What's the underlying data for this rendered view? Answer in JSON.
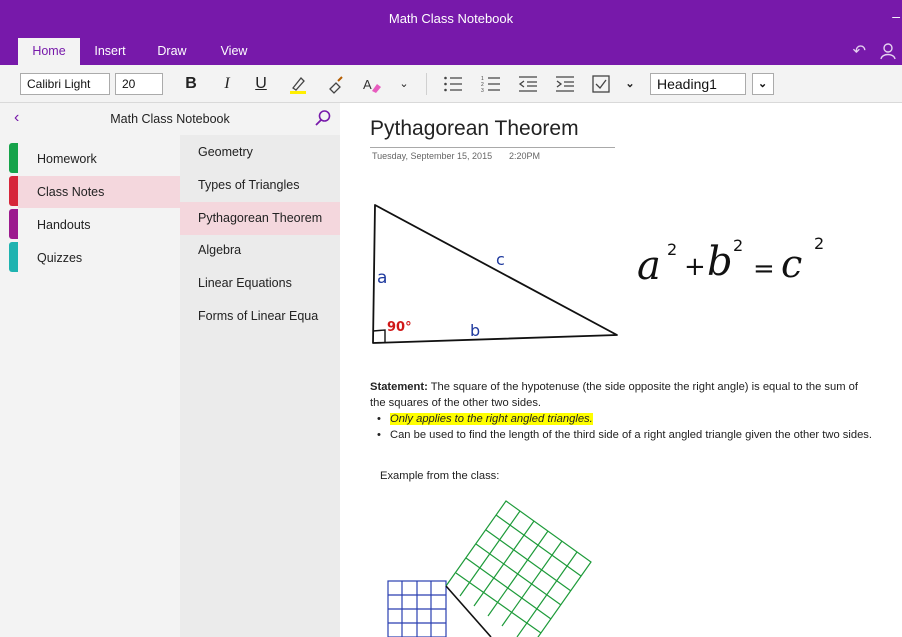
{
  "app": {
    "title": "Math Class Notebook",
    "accent": "#7719aa",
    "minimize_glyph": "–"
  },
  "ribbon": {
    "tabs": [
      {
        "label": "Home",
        "active": true
      },
      {
        "label": "Insert",
        "active": false
      },
      {
        "label": "Draw",
        "active": false
      },
      {
        "label": "View",
        "active": false
      }
    ],
    "icons": [
      "undo-icon",
      "person-icon"
    ]
  },
  "toolbar": {
    "font_name": "Calibri Light",
    "font_size": "20",
    "bold": "B",
    "italic": "I",
    "underline": "U",
    "style": "Heading1",
    "icons": [
      "highlighter-icon",
      "format-painter-icon",
      "font-color-icon",
      "chevron-down-icon",
      "bullet-list-icon",
      "numbered-list-icon",
      "outdent-icon",
      "indent-icon",
      "todo-checkbox-icon",
      "chevron-down-icon",
      "style-dropdown-icon"
    ]
  },
  "notebook": {
    "name": "Math Class Notebook",
    "sections": [
      {
        "label": "Homework",
        "color": "#16a34a"
      },
      {
        "label": "Class Notes",
        "color": "#d6263a",
        "active": true
      },
      {
        "label": "Handouts",
        "color": "#9c1a8e"
      },
      {
        "label": "Quizzes",
        "color": "#1fb3b0"
      }
    ],
    "pages": [
      {
        "label": "Geometry"
      },
      {
        "label": "Types of Triangles"
      },
      {
        "label": "Pythagorean Theorem",
        "active": true
      },
      {
        "label": "Algebra"
      },
      {
        "label": "Linear Equations"
      },
      {
        "label": "Forms of Linear Equa"
      }
    ]
  },
  "page": {
    "title": "Pythagorean Theorem",
    "date": "Tuesday, September 15, 2015",
    "time": "2:20PM",
    "ink": {
      "side_a": "a",
      "side_b": "b",
      "side_c": "c",
      "angle": "90°",
      "formula_a": "a",
      "formula_b": "b",
      "formula_c": "c",
      "exp": "2",
      "plus": "+",
      "equals": "="
    },
    "statement_label": "Statement:",
    "statement_text": " The square of the hypotenuse (the side opposite the right angle) is equal to the sum of the squares of the other two sides.",
    "bullets": [
      {
        "text": "Only applies to the right angled triangles.",
        "highlight": "#ffff00"
      },
      {
        "text": "Can be used to find the length of the third side of a right angled triangle given the other two sides."
      }
    ],
    "example_label": "Example from the class:"
  }
}
